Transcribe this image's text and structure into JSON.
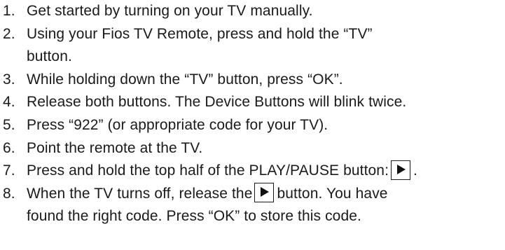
{
  "steps": [
    {
      "number": "1.",
      "lines": [
        "Get started by turning on your TV manually."
      ]
    },
    {
      "number": "2.",
      "lines": [
        "Using your Fios TV Remote, press and hold the “TV”",
        "button."
      ]
    },
    {
      "number": "3.",
      "lines": [
        "While holding down the “TV” button, press “OK”."
      ]
    },
    {
      "number": "4.",
      "lines": [
        "Release both buttons. The Device Buttons will blink twice."
      ]
    },
    {
      "number": "5.",
      "lines": [
        "Press “922” (or appropriate code for your TV)."
      ]
    },
    {
      "number": "6.",
      "lines": [
        "Point the remote at the TV."
      ]
    },
    {
      "number": "7.",
      "text_before": "Press and hold the top half of the PLAY/PAUSE button:",
      "text_after": "."
    },
    {
      "number": "8.",
      "text_before": "When the TV turns off, release the",
      "text_after": "button. You have",
      "line2": "found the right code. Press “OK” to store this code."
    }
  ],
  "icons": {
    "play": "play-icon"
  }
}
